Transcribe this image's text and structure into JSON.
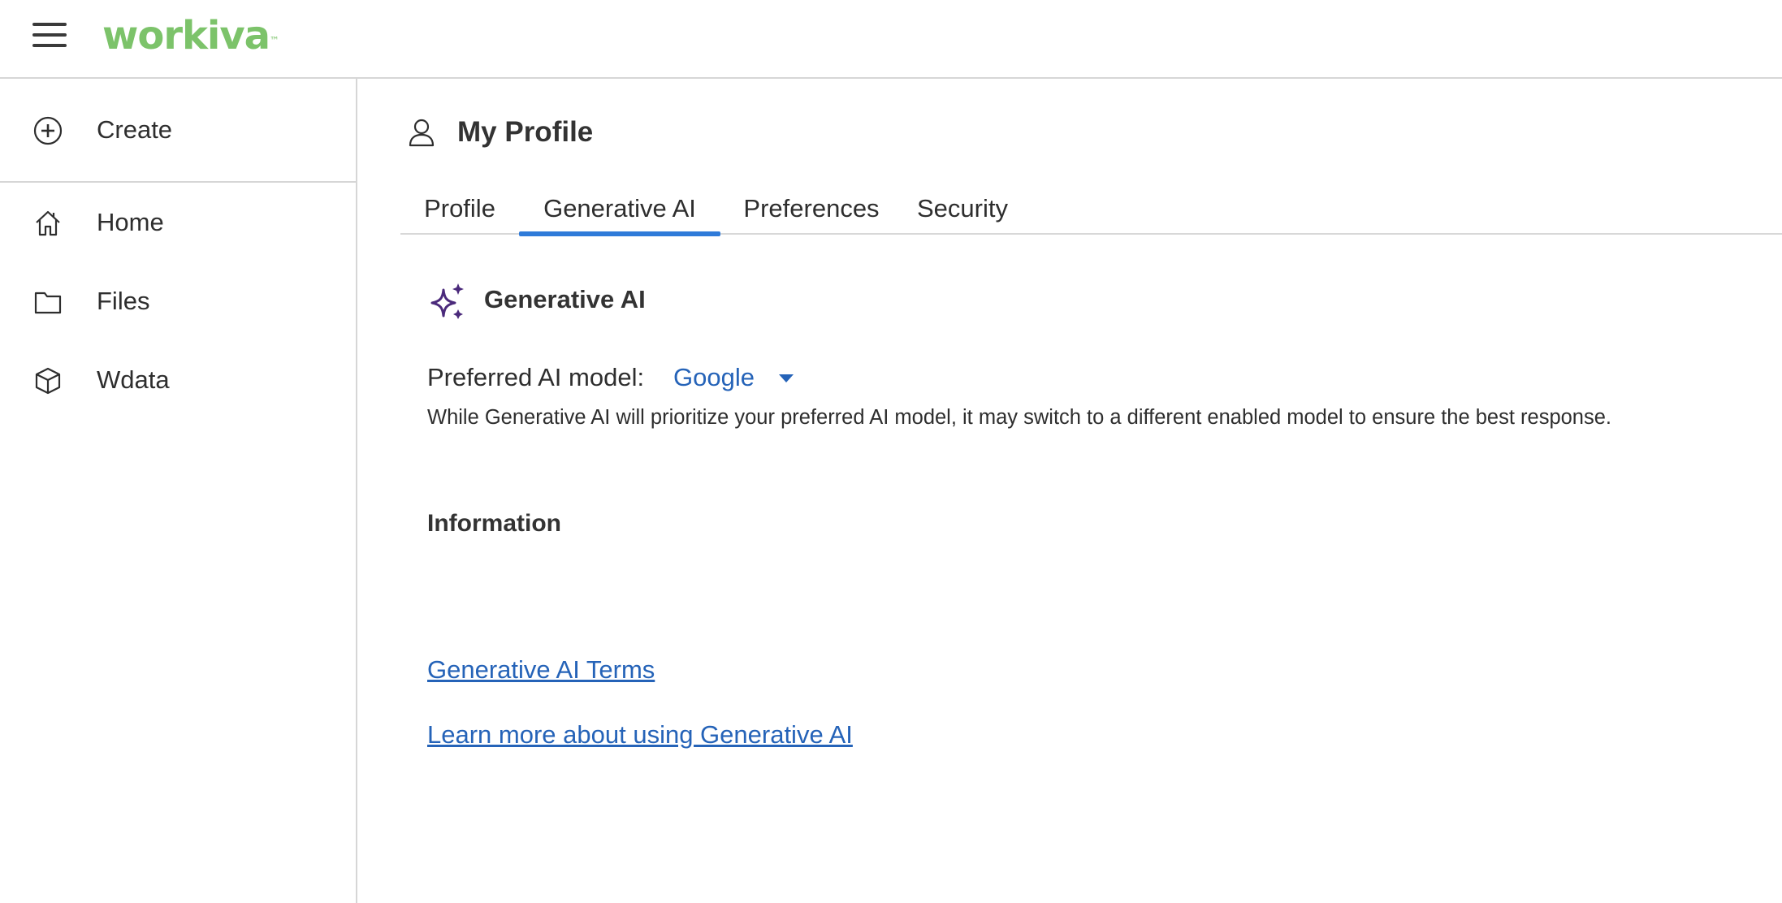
{
  "header": {
    "menu_icon": "hamburger-menu-icon",
    "logo_text": "workiva",
    "logo_mark": "™",
    "brand_color": "#7cc36a"
  },
  "sidebar": {
    "create": {
      "label": "Create",
      "icon": "plus-circle-icon"
    },
    "items": [
      {
        "label": "Home",
        "icon": "home-icon"
      },
      {
        "label": "Files",
        "icon": "folder-icon"
      },
      {
        "label": "Wdata",
        "icon": "cube-icon"
      }
    ]
  },
  "main": {
    "title": "My Profile",
    "title_icon": "user-icon",
    "tabs": [
      {
        "label": "Profile",
        "active": false
      },
      {
        "label": "Generative AI",
        "active": true
      },
      {
        "label": "Preferences",
        "active": false
      },
      {
        "label": "Security",
        "active": false
      }
    ],
    "section": {
      "title": "Generative AI",
      "icon": "sparkle-icon",
      "icon_color": "#4b2a7b",
      "preferred_model_label": "Preferred AI model:",
      "preferred_model_value": "Google",
      "help_text": "While Generative AI will prioritize your preferred AI model, it may switch to a different enabled model to ensure the best response."
    },
    "information": {
      "title": "Information",
      "links": [
        "Generative AI Terms",
        "Learn more about using Generative AI"
      ]
    }
  },
  "colors": {
    "accent": "#2f7bd9",
    "link": "#2563b8",
    "divider": "#d6d6d6"
  }
}
